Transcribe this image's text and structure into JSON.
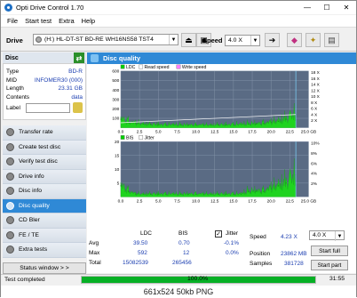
{
  "window": {
    "title": "Opti Drive Control 1.70",
    "min": "—",
    "max": "☐",
    "close": "✕"
  },
  "menu": [
    "File",
    "Start test",
    "Extra",
    "Help"
  ],
  "drivebar": {
    "drive_label": "Drive",
    "drive_value": "(H:)  HL-DT-ST BD-RE  WH16NS58 TST4",
    "speed_label": "Speed",
    "speed_value": "4.0 X"
  },
  "disc": {
    "header": "Disc",
    "fields": [
      {
        "k": "Type",
        "v": "BD-R"
      },
      {
        "k": "MID",
        "v": "INFOMER30 (000)"
      },
      {
        "k": "Length",
        "v": "23.31 GB"
      },
      {
        "k": "Contents",
        "v": "data"
      }
    ],
    "label_key": "Label"
  },
  "nav": [
    {
      "label": "Transfer rate",
      "active": false
    },
    {
      "label": "Create test disc",
      "active": false
    },
    {
      "label": "Verify test disc",
      "active": false
    },
    {
      "label": "Drive info",
      "active": false
    },
    {
      "label": "Disc info",
      "active": false
    },
    {
      "label": "Disc quality",
      "active": true
    },
    {
      "label": "CD Bler",
      "active": false
    },
    {
      "label": "FE / TE",
      "active": false
    },
    {
      "label": "Extra tests",
      "active": false
    }
  ],
  "status_window_btn": "Status window > >",
  "panel_title": "Disc quality",
  "chart_data": [
    {
      "type": "line",
      "legend": [
        "LDC",
        "Read speed",
        "Write speed"
      ],
      "x_ticks": [
        "0.0",
        "2.5",
        "5.0",
        "7.5",
        "10.0",
        "12.5",
        "15.0",
        "17.5",
        "20.0",
        "22.5",
        "25.0 GB"
      ],
      "y_left_ticks": [
        "600",
        "500",
        "400",
        "300",
        "200",
        "100"
      ],
      "y_right_ticks": [
        "18 X",
        "16 X",
        "14 X",
        "12 X",
        "10 X",
        "8 X",
        "6 X",
        "4 X",
        "2 X"
      ],
      "xlim": [
        0,
        25
      ],
      "ylim": [
        0,
        600
      ],
      "series": [
        {
          "name": "LDC",
          "x": [
            0,
            1,
            2,
            3,
            4,
            5,
            6,
            7,
            8,
            9,
            10,
            11,
            12,
            13,
            14,
            15,
            16,
            17,
            18,
            19,
            20,
            21,
            22,
            23.3
          ],
          "values": [
            90,
            60,
            45,
            40,
            35,
            32,
            30,
            30,
            30,
            28,
            28,
            28,
            28,
            30,
            30,
            32,
            34,
            40,
            40,
            45,
            55,
            70,
            90,
            150
          ]
        },
        {
          "name": "Read speed",
          "x": [
            0,
            23.3
          ],
          "values": [
            1.6,
            4.2
          ]
        }
      ]
    },
    {
      "type": "line",
      "legend": [
        "BIS",
        "Jitter"
      ],
      "x_ticks": [
        "0.0",
        "2.5",
        "5.0",
        "7.5",
        "10.0",
        "12.5",
        "15.0",
        "17.5",
        "20.0",
        "22.5",
        "25.0 GB"
      ],
      "y_left_ticks": [
        "20",
        "15",
        "10",
        "5"
      ],
      "y_right_ticks": [
        "10%",
        "8%",
        "6%",
        "4%",
        "2%"
      ],
      "xlim": [
        0,
        25
      ],
      "ylim": [
        0,
        20
      ],
      "series": [
        {
          "name": "BIS",
          "x": [
            0,
            1,
            2,
            3,
            4,
            5,
            6,
            7,
            8,
            9,
            10,
            11,
            12,
            13,
            14,
            15,
            16,
            17,
            18,
            19,
            20,
            21,
            22,
            23.3
          ],
          "values": [
            4,
            2,
            1,
            1,
            1,
            1,
            1,
            1,
            1,
            1,
            1,
            1,
            1,
            1,
            1,
            1,
            1,
            2,
            2,
            2,
            3,
            4,
            5,
            8
          ]
        }
      ]
    }
  ],
  "stats": {
    "cols": [
      "LDC",
      "BIS"
    ],
    "rows": [
      {
        "name": "Avg",
        "ldc": "39.50",
        "bis": "0.70",
        "jitter": "-0.1%"
      },
      {
        "name": "Max",
        "ldc": "592",
        "bis": "12",
        "jitter": "0.0%"
      },
      {
        "name": "Total",
        "ldc": "15082539",
        "bis": "265456",
        "jitter": ""
      }
    ],
    "jitter_label": "Jitter",
    "speed_label": "Speed",
    "speed_value": "4.23 X",
    "speed_select": "4.0 X",
    "position_label": "Position",
    "position_value": "23862 MB",
    "samples_label": "Samples",
    "samples_value": "381728",
    "start_full": "Start full",
    "start_part": "Start part"
  },
  "statusbar": {
    "text": "Test completed",
    "progress": "100.0%",
    "time": "31:55"
  },
  "caption": "661x524  50kb  PNG"
}
